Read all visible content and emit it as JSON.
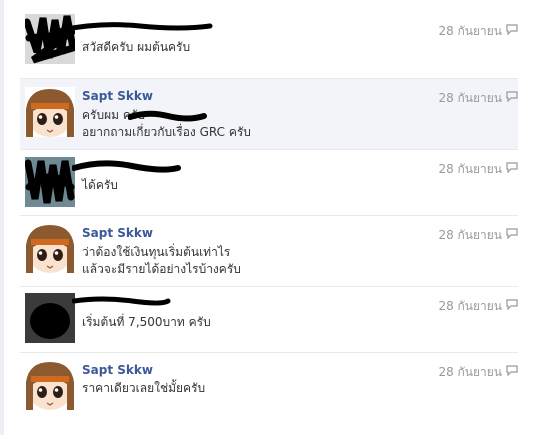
{
  "messages": [
    {
      "sender": "",
      "avatar": "redacted-avatar",
      "lines": [
        "สวัสดีครับ ผมต้นครับ"
      ],
      "time": "28 กันยายน",
      "highlighted": false
    },
    {
      "sender": "Sapt Skkw",
      "avatar": "anime-avatar",
      "lines": [
        "ครับผม ครับ",
        "อยากถามเกี่ยวกับเรื่อง GRC ครับ"
      ],
      "time": "28 กันยายน",
      "highlighted": true
    },
    {
      "sender": "",
      "avatar": "redacted-avatar",
      "lines": [
        "ได้ครับ"
      ],
      "time": "28 กันยายน",
      "highlighted": false
    },
    {
      "sender": "Sapt Skkw",
      "avatar": "anime-avatar",
      "lines": [
        "ว่าต้องใช้เงินทุนเริ่มต้นเท่าไร",
        "แล้วจะมีรายได้อย่างไรบ้างครับ"
      ],
      "time": "28 กันยายน",
      "highlighted": false
    },
    {
      "sender": "",
      "avatar": "redacted-avatar",
      "lines": [
        "เริ่มต้นที่ 7,500บาท ครับ"
      ],
      "time": "28 กันยายน",
      "highlighted": false
    },
    {
      "sender": "Sapt Skkw",
      "avatar": "anime-avatar",
      "lines": [
        "ราคาเดียวเลยใช่มั้ยครับ"
      ],
      "time": "28 กันยายน",
      "highlighted": false
    }
  ],
  "colors": {
    "sender": "#3b5998",
    "timestamp": "#999999",
    "highlight_bg": "#f2f4f9"
  },
  "icons": {
    "reply": "reply-icon"
  }
}
